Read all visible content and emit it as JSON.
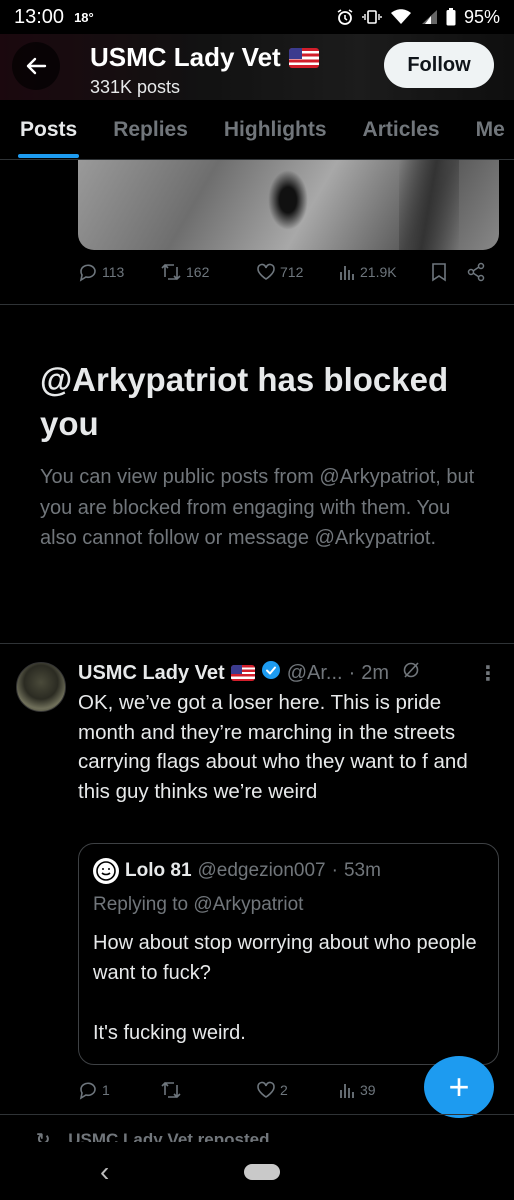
{
  "status_bar": {
    "time": "13:00",
    "temperature": "18°",
    "battery": "95%"
  },
  "profile_header": {
    "name": "USMC Lady Vet",
    "flag_emoji": "us-flag",
    "post_count": "331K posts",
    "follow_label": "Follow"
  },
  "tabs": [
    {
      "label": "Posts",
      "active": true
    },
    {
      "label": "Replies",
      "active": false
    },
    {
      "label": "Highlights",
      "active": false
    },
    {
      "label": "Articles",
      "active": false
    },
    {
      "label": "Me",
      "active": false
    }
  ],
  "previous_tweet_actions": {
    "replies": "113",
    "reposts": "162",
    "likes": "712",
    "views": "21.9K"
  },
  "blocked_notice": {
    "title": "@Arkypatriot has blocked you",
    "body": "You can view public posts from @Arkypatriot, but you are blocked from engaging with them. You also cannot follow or message @Arkypatriot."
  },
  "tweet": {
    "author_name": "USMC Lady Vet",
    "handle": "@Ar...",
    "separator": "·",
    "time": "2m",
    "text": "OK, we’ve got a loser here. This is pride month and they’re marching in the streets carrying flags about who they want to f  and this guy thinks we’re weird",
    "quote": {
      "name": "Lolo 81",
      "handle": "@edgezion007",
      "separator": "·",
      "time": "53m",
      "replying_to": "Replying to @Arkypatriot",
      "text_line1": "How about stop worrying about who people want to fuck?",
      "text_line2": "It's fucking weird."
    },
    "actions": {
      "replies": "1",
      "reposts": "",
      "likes": "2",
      "views": "39"
    }
  },
  "next_item": {
    "reposted_label": "USMC Lady Vet reposted"
  },
  "colors": {
    "accent": "#1d9bf0",
    "background": "#000000",
    "muted_text": "#71767b",
    "primary_text": "#e7e9ea"
  }
}
